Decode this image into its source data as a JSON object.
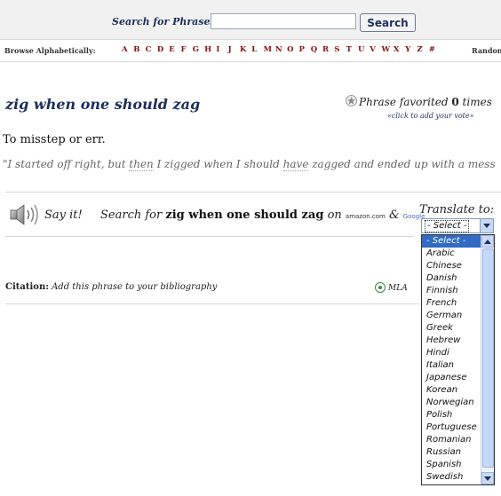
{
  "header": {
    "search_label": "Search for Phrases:",
    "search_value": "",
    "search_button": "Search",
    "browse_label": "Browse Alphabetically:",
    "letters": [
      "A",
      "B",
      "C",
      "D",
      "E",
      "F",
      "G",
      "H",
      "I",
      "J",
      "K",
      "L",
      "M",
      "N",
      "O",
      "P",
      "Q",
      "R",
      "S",
      "T",
      "U",
      "V",
      "W",
      "X",
      "Y",
      "Z",
      "#"
    ],
    "random_label": "Random"
  },
  "phrase": {
    "title": "zig when one should zag",
    "favorite_prefix": "Phrase favorited ",
    "favorite_count": "0",
    "favorite_suffix": " times",
    "vote_link": "«click to add your vote»",
    "definition": "To misstep or err.",
    "example_start": "\"I started off right, but ",
    "example_u1": "then",
    "example_mid": " I zigged when I should ",
    "example_u2": "have",
    "example_end": " zagged and ended up with a mess"
  },
  "say_it": {
    "label": "Say it!",
    "search_prefix": "Search for ",
    "search_term": "zig when one should zag",
    "on_text": " on ",
    "amazon": "amazon.com",
    "amp": " & ",
    "google": "Google"
  },
  "citation": {
    "label": "Citation:",
    "text": " Add this phrase to your bibliography",
    "mla_label": "MLA"
  },
  "translate": {
    "label": "Translate to:",
    "selected": "- Select -",
    "options": [
      "- Select -",
      "Arabic",
      "Chinese",
      "Danish",
      "Finnish",
      "French",
      "German",
      "Greek",
      "Hebrew",
      "Hindi",
      "Italian",
      "Japanese",
      "Korean",
      "Norwegian",
      "Polish",
      "Portuguese",
      "Romanian",
      "Russian",
      "Spanish",
      "Swedish"
    ]
  },
  "colors": {
    "header_bg": "#f1f1f1",
    "title_navy": "#1c2f5c",
    "letter_red": "#8a1010",
    "selection_blue": "#316ac5"
  }
}
